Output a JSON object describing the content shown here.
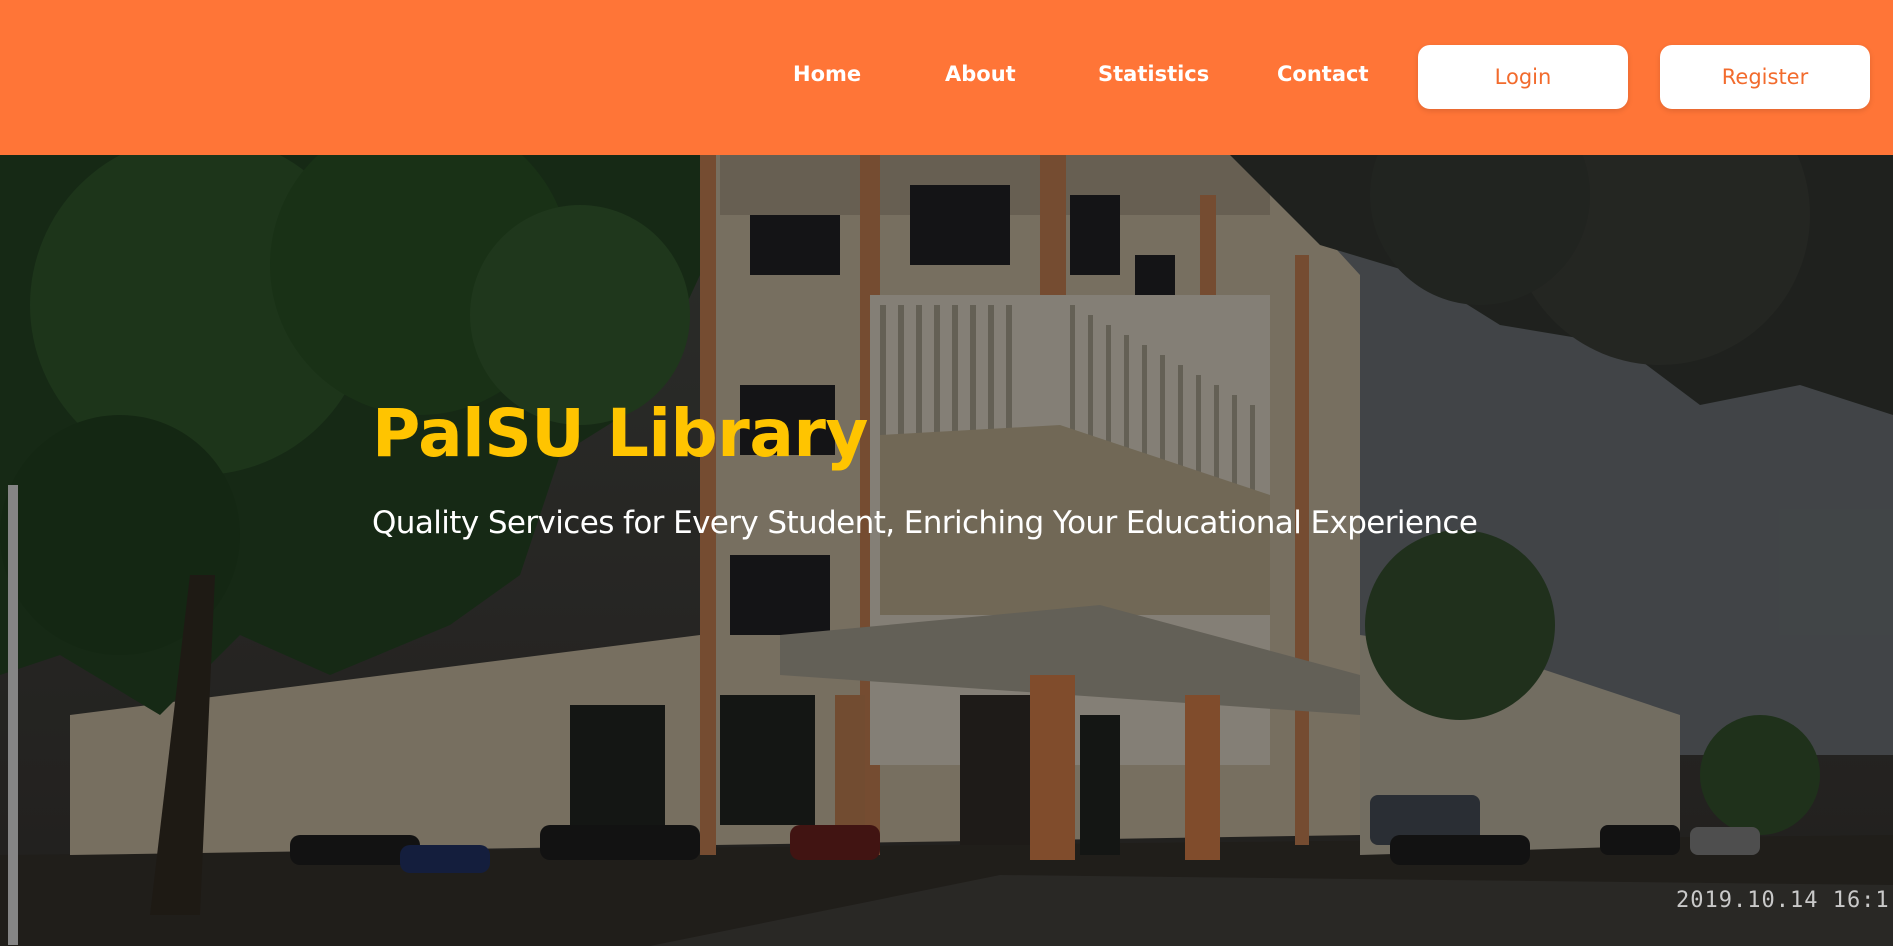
{
  "nav": {
    "links": [
      "Home",
      "About",
      "Statistics",
      "Contact"
    ],
    "login_label": "Login",
    "register_label": "Register"
  },
  "hero": {
    "title": "PalSU Library",
    "subtitle": "Quality Services for Every Student, Enriching Your Educational Experience",
    "photo_timestamp": "2019.10.14 16:1"
  },
  "colors": {
    "nav_background": "#ff7537",
    "title": "#ffc400",
    "button_text": "#f26b2d"
  },
  "icons": []
}
